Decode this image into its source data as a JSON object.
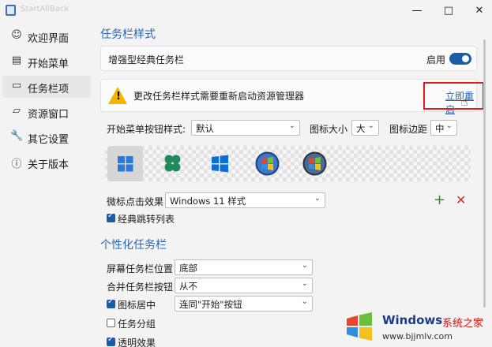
{
  "window": {
    "title": "StartAllBack",
    "controls": {
      "minimize": "—",
      "maximize": "□",
      "close": "✕"
    }
  },
  "sidebar": {
    "items": [
      {
        "label": "欢迎界面",
        "icon": "smile-icon",
        "glyph": "☺",
        "active": false
      },
      {
        "label": "开始菜单",
        "icon": "start-menu-icon",
        "glyph": "▤",
        "active": false
      },
      {
        "label": "任务栏项",
        "icon": "taskbar-icon",
        "glyph": "▭",
        "active": true
      },
      {
        "label": "资源窗口",
        "icon": "folder-icon",
        "glyph": "▱",
        "active": false
      },
      {
        "label": "其它设置",
        "icon": "wrench-icon",
        "glyph": "🔧",
        "active": false
      },
      {
        "label": "关于版本",
        "icon": "info-icon",
        "glyph": "ⓘ",
        "active": false
      }
    ]
  },
  "taskbar_style": {
    "section_title": "任务栏样式",
    "enhanced_label": "增强型经典任务栏",
    "toggle_label": "启用",
    "toggle_on": true,
    "warning_text": "更改任务栏样式需要重新启动资源管理器",
    "restart_link": "立即重启",
    "start_button_label": "开始菜单按钮样式:",
    "start_button_value": "默认",
    "icon_size_label": "图标大小",
    "icon_size_value": "大",
    "icon_margin_label": "图标边距",
    "icon_margin_value": "中",
    "logos": [
      "windows11-logo",
      "clover-logo",
      "windows10-logo",
      "windows7-orb",
      "windows7-orb-alt"
    ],
    "selected_logo_index": 0,
    "click_effect_label": "微标点击效果",
    "click_effect_value": "Windows 11 样式",
    "classic_jump_label": "经典跳转列表",
    "classic_jump_checked": true,
    "add_symbol": "+",
    "remove_symbol": "✕"
  },
  "personalize": {
    "section_title": "个性化任务栏",
    "rows": [
      {
        "label": "屏幕任务栏位置",
        "value": "底部",
        "checkbox": null
      },
      {
        "label": "合并任务栏按钮",
        "value": "从不",
        "checkbox": null
      },
      {
        "label": "图标居中",
        "value": "连同\"开始\"按钮",
        "checkbox": true
      },
      {
        "label": "任务分组",
        "value": null,
        "checkbox": false
      },
      {
        "label": "透明效果",
        "value": null,
        "checkbox": true
      }
    ]
  },
  "watermark": {
    "brand": "Windows",
    "brand_cn": "系统之家",
    "url": "www.bjjmlv.com"
  },
  "colors": {
    "accent": "#1c5ca9",
    "section_title": "#2a65b8",
    "warning": "#f5b400",
    "highlight_box": "#e01d1d",
    "add": "#2e8b3a",
    "remove": "#c0392b"
  }
}
